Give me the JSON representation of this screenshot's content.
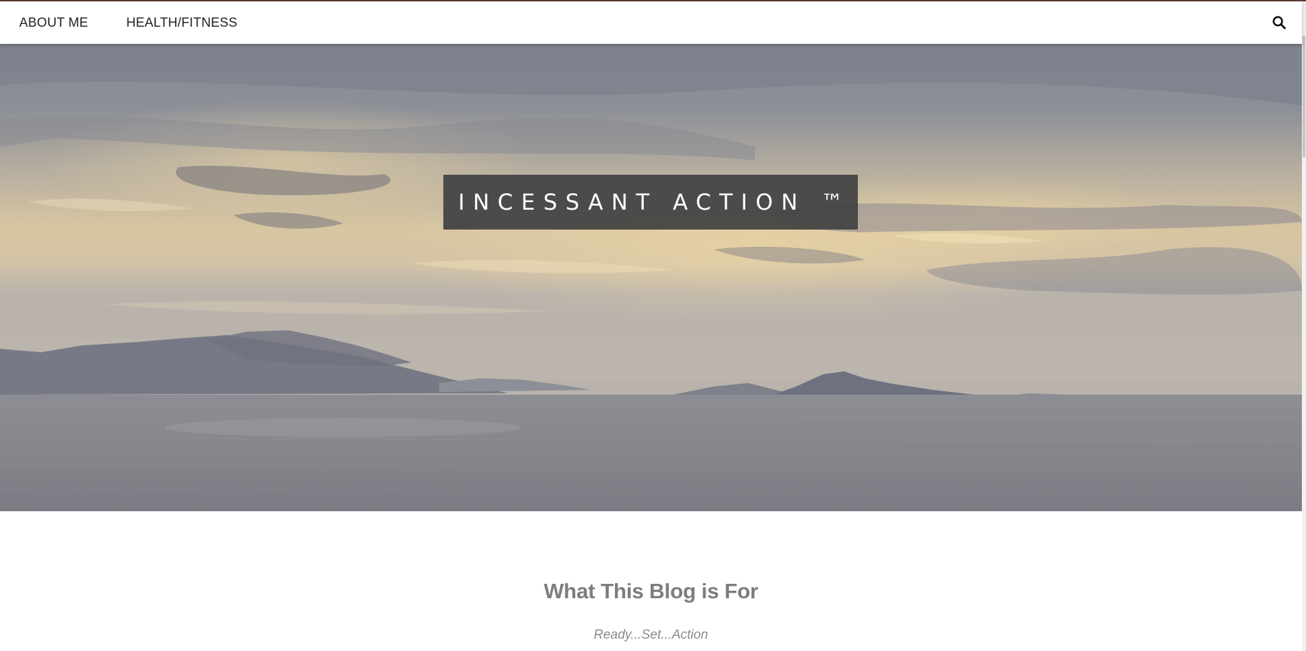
{
  "nav": {
    "items": [
      {
        "label": "ABOUT ME"
      },
      {
        "label": "HEALTH/FITNESS"
      }
    ],
    "search_icon": "search-icon"
  },
  "hero": {
    "site_title": "INCESSANT ACTION ™",
    "image_description_icon": "sunset-sea-mountains"
  },
  "post": {
    "title": "What This Blog is For",
    "tagline": "Ready...Set...Action"
  },
  "colors": {
    "title_box": "#444444",
    "nav_text": "#222222",
    "post_title": "#7d7d7d",
    "tagline": "#8a8a8a"
  }
}
